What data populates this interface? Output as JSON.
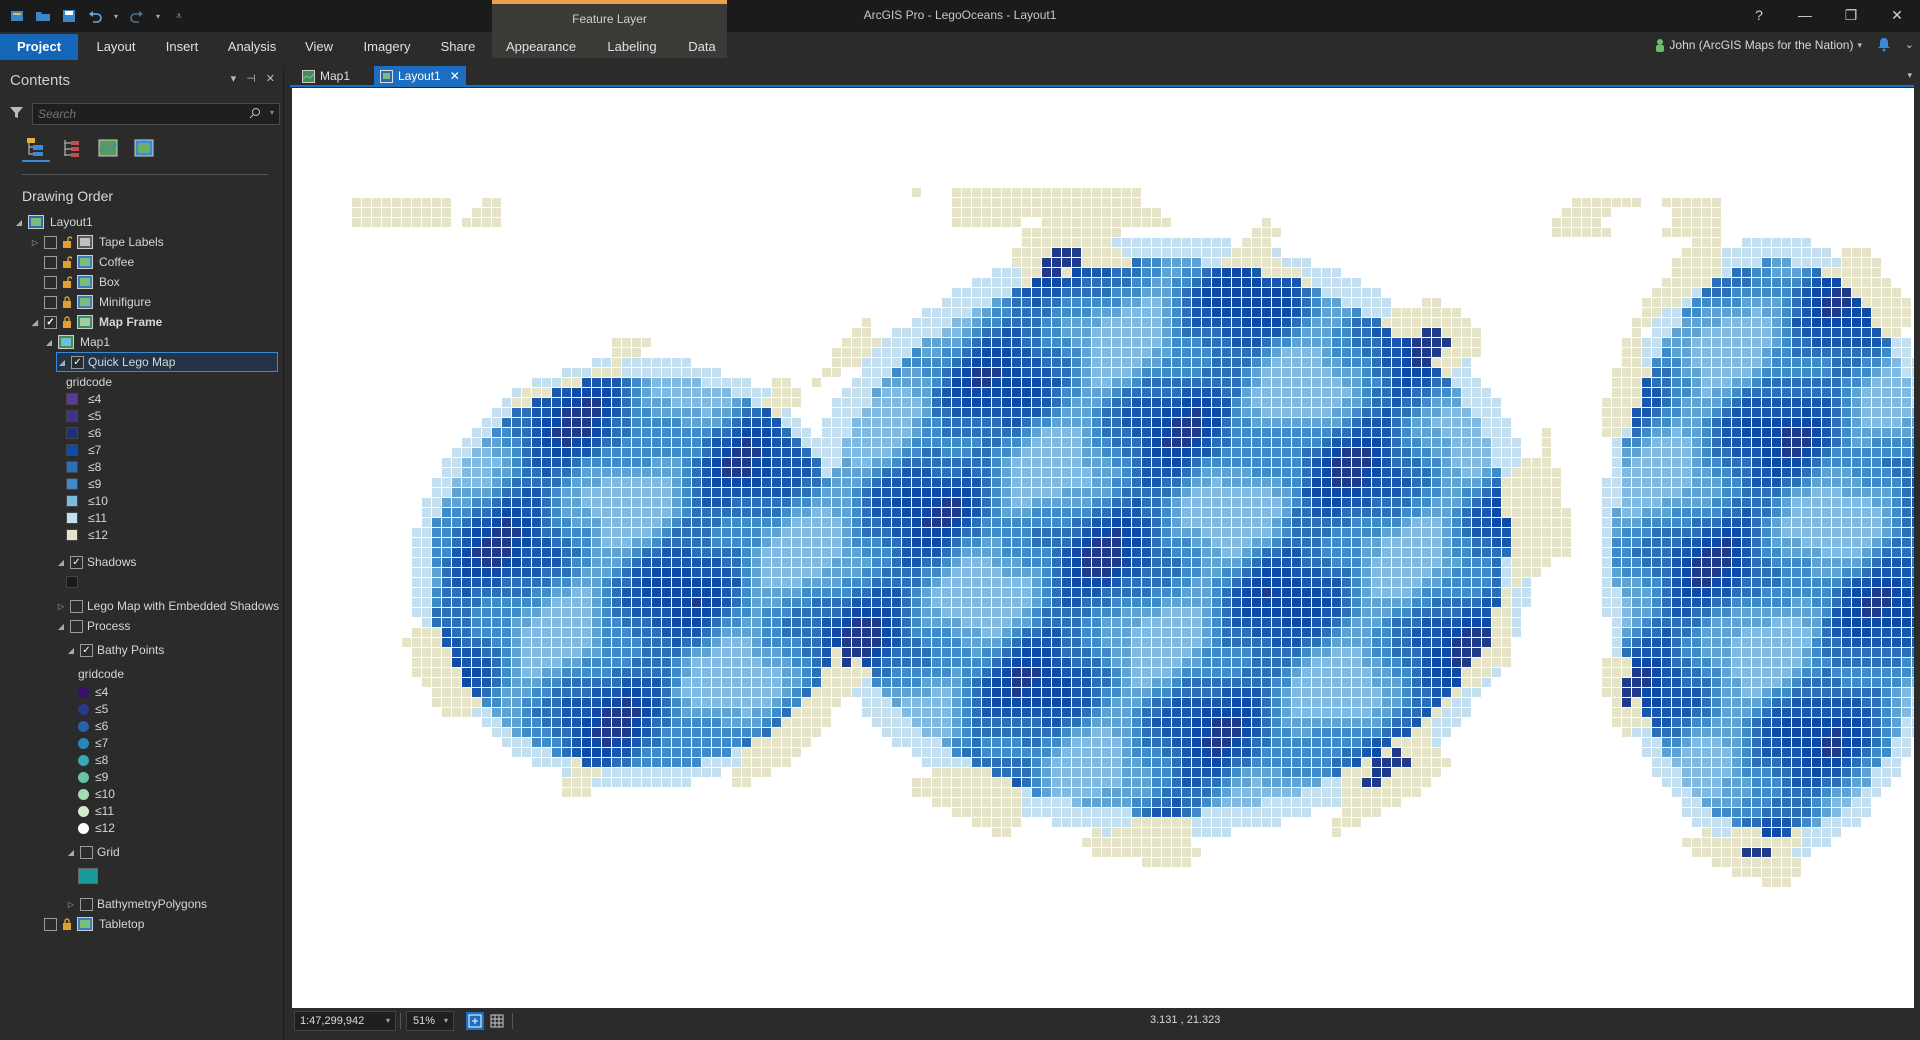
{
  "app": {
    "title": "ArcGIS Pro - LegoOceans - Layout1",
    "contextual_group": "Feature Layer",
    "user": "John (ArcGIS Maps for the Nation)"
  },
  "ribbon": {
    "tabs": [
      "Project",
      "Layout",
      "Insert",
      "Analysis",
      "View",
      "Imagery",
      "Share",
      "Appearance",
      "Labeling",
      "Data"
    ],
    "active": "Project"
  },
  "window": {
    "help": "?",
    "minimize": "—",
    "restore": "❐",
    "close": "✕"
  },
  "contents": {
    "title": "Contents",
    "search_placeholder": "Search",
    "section": "Drawing Order",
    "tree": [
      {
        "label": "Layout1",
        "indent": 0,
        "expander": "◢",
        "checkbox": false,
        "lock": false,
        "icon": "layout-icon"
      },
      {
        "label": "Tape Labels",
        "indent": 1,
        "expander": "▷",
        "checkbox": "off",
        "lock": "open",
        "icon": "group-icon"
      },
      {
        "label": "Coffee",
        "indent": 1,
        "expander": "",
        "checkbox": "off",
        "lock": "open",
        "icon": "picture-icon"
      },
      {
        "label": "Box",
        "indent": 1,
        "expander": "",
        "checkbox": "off",
        "lock": "open",
        "icon": "picture-icon"
      },
      {
        "label": "Minifigure",
        "indent": 1,
        "expander": "",
        "checkbox": "off",
        "lock": "closed",
        "icon": "picture-icon"
      },
      {
        "label": "Map Frame",
        "indent": 1,
        "expander": "◢",
        "checkbox": "on",
        "lock": "closed",
        "icon": "map-frame-icon",
        "bold": true
      },
      {
        "label": "Map1",
        "indent": 2,
        "expander": "◢",
        "checkbox": false,
        "lock": false,
        "icon": "map-icon"
      },
      {
        "label": "Quick Lego Map",
        "indent": 3,
        "expander": "◢",
        "checkbox": "on",
        "lock": false,
        "icon": "",
        "selected": true
      },
      {
        "label": "gridcode",
        "indent": 4,
        "header": true
      },
      {
        "label": "≤4",
        "indent": 4,
        "swatch": "#5b3a9a"
      },
      {
        "label": "≤5",
        "indent": 4,
        "swatch": "#3d2f8a"
      },
      {
        "label": "≤6",
        "indent": 4,
        "swatch": "#1f2f78"
      },
      {
        "label": "≤7",
        "indent": 4,
        "swatch": "#0f4aa8"
      },
      {
        "label": "≤8",
        "indent": 4,
        "swatch": "#2a6fb8"
      },
      {
        "label": "≤9",
        "indent": 4,
        "swatch": "#3f8ac8"
      },
      {
        "label": "≤10",
        "indent": 4,
        "swatch": "#7fb8e0"
      },
      {
        "label": "≤11",
        "indent": 4,
        "swatch": "#c4dff0"
      },
      {
        "label": "≤12",
        "indent": 4,
        "swatch": "#e6e4c8"
      },
      {
        "label": "Shadows",
        "indent": 3,
        "expander": "◢",
        "checkbox": "on",
        "lock": false,
        "icon": ""
      },
      {
        "label": "",
        "indent": 4,
        "swatch": "#1a1a1a"
      },
      {
        "label": "Lego Map with Embedded Shadows",
        "indent": 3,
        "expander": "▷",
        "checkbox": "off",
        "lock": false,
        "icon": ""
      },
      {
        "label": "Process",
        "indent": 3,
        "expander": "◢",
        "checkbox": "off",
        "lock": false,
        "icon": ""
      },
      {
        "label": "Bathy Points",
        "indent": 4,
        "expander": "◢",
        "checkbox": "on",
        "lock": false,
        "icon": ""
      },
      {
        "label": "gridcode",
        "indent": 5,
        "header": true
      },
      {
        "label": "≤4",
        "indent": 5,
        "dot": "#3a0f6a"
      },
      {
        "label": "≤5",
        "indent": 5,
        "dot": "#273a8a"
      },
      {
        "label": "≤6",
        "indent": 5,
        "dot": "#2a62a8"
      },
      {
        "label": "≤7",
        "indent": 5,
        "dot": "#2a86b8"
      },
      {
        "label": "≤8",
        "indent": 5,
        "dot": "#3aa8b0"
      },
      {
        "label": "≤9",
        "indent": 5,
        "dot": "#6ac4a8"
      },
      {
        "label": "≤10",
        "indent": 5,
        "dot": "#a4dab4"
      },
      {
        "label": "≤11",
        "indent": 5,
        "dot": "#d6ecc8"
      },
      {
        "label": "≤12",
        "indent": 5,
        "dot": "#ffffff"
      },
      {
        "label": "Grid",
        "indent": 4,
        "expander": "◢",
        "checkbox": "off",
        "lock": false,
        "icon": ""
      },
      {
        "label": "",
        "indent": 5,
        "swatch_big": "#1a9a9a"
      },
      {
        "label": "BathymetryPolygons",
        "indent": 4,
        "expander": "▷",
        "checkbox": "off",
        "lock": false,
        "icon": ""
      },
      {
        "label": "Tabletop",
        "indent": 1,
        "expander": "",
        "checkbox": "off",
        "lock": "closed",
        "icon": "picture-icon"
      }
    ]
  },
  "doc_tabs": [
    {
      "label": "Map1",
      "active": false
    },
    {
      "label": "Layout1",
      "active": true
    }
  ],
  "status": {
    "scale": "1:47,299,942",
    "zoom": "51%",
    "coords": "3.131 , 21.323"
  },
  "colors": {
    "accent": "#1466b8",
    "ctx_tab": "#e8a04a",
    "land": "#e6e4c8",
    "deep": "#0f4aa8",
    "mid": "#2a6fb8",
    "shallow": "#7fb8e0"
  }
}
